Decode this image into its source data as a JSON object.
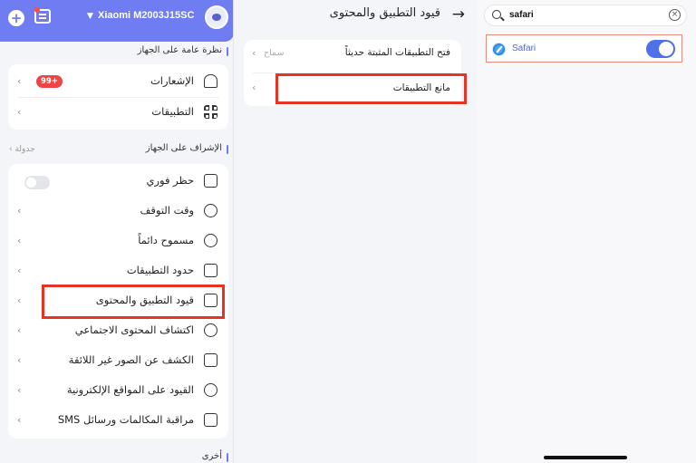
{
  "topbar": {
    "device_name": "Xiaomi M2003J15SC",
    "add_icon": "plus-icon",
    "chat_icon": "chat-icon"
  },
  "sections": {
    "overview_title": "نظرة عامة على الجهاز",
    "supervision_title": "الإشراف على الجهاز",
    "schedule_link": "جدولة",
    "other_title": "أخرى"
  },
  "overview": [
    {
      "label": "الإشعارات",
      "badge": "99+",
      "icon": "bell-icon"
    },
    {
      "label": "التطبيقات",
      "icon": "apps-grid-icon"
    }
  ],
  "supervision": [
    {
      "label": "حظر فوري",
      "icon": "lock-icon",
      "toggle": false
    },
    {
      "label": "وقت التوقف",
      "icon": "clock-icon"
    },
    {
      "label": "مسموح دائماً",
      "icon": "check-shield-icon"
    },
    {
      "label": "حدود التطبيقات",
      "icon": "box-icon"
    },
    {
      "label": "قيود التطبيق والمحتوى",
      "icon": "doc-gear-icon"
    },
    {
      "label": "اكتشاف المحتوى الاجتماعي",
      "icon": "eye-icon"
    },
    {
      "label": "الكشف عن الصور غير اللائقة",
      "icon": "image-icon"
    },
    {
      "label": "القيود على المواقع الإلكترونية",
      "icon": "planet-icon"
    },
    {
      "label": "مراقبة المكالمات ورسائل SMS",
      "icon": "message-icon"
    }
  ],
  "middle": {
    "title": "قيود التطبيق والمحتوى",
    "row1_label": "فتح التطبيقات المثبتة حديثاً",
    "row1_value": "سماح",
    "row2_label": "مانع التطبيقات"
  },
  "right": {
    "search_query": "safari",
    "app_name": "Safari",
    "app_toggle": true
  },
  "colors": {
    "accent": "#6f7cf2",
    "highlight": "#e53423",
    "toggle_on": "#4f70e8"
  }
}
